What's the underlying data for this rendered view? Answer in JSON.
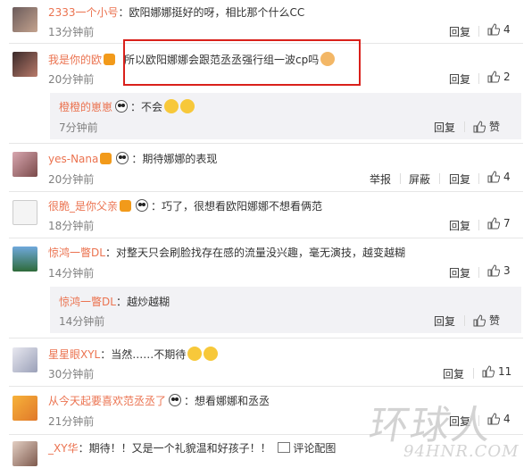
{
  "comments": [
    {
      "name": "2333一个小号",
      "text": "：欧阳娜娜挺好的呀，相比那个什么CC",
      "time": "13分钟前",
      "actions": [
        "回复"
      ],
      "likes": "4"
    },
    {
      "name": "我是你的欧",
      "text": "所以欧阳娜娜会跟范丞丞强行组一波cp吗",
      "time": "20分钟前",
      "actions": [
        "回复"
      ],
      "likes": "2"
    },
    {
      "name": "yes-Nana",
      "text": "：期待娜娜的表现",
      "time": "20分钟前",
      "actions": [
        "举报",
        "屏蔽",
        "回复"
      ],
      "likes": "4"
    },
    {
      "name": "很脆_是你父亲",
      "text": "：巧了，很想看欧阳娜娜不想看俩范",
      "time": "18分钟前",
      "actions": [
        "回复"
      ],
      "likes": "7"
    },
    {
      "name": "惊鸿一瞥DL",
      "text": "：对整天只会刷脸找存在感的流量没兴趣，毫无演技，越变越糊",
      "time": "14分钟前",
      "actions": [
        "回复"
      ],
      "likes": "3"
    },
    {
      "name": "星星眼XYL",
      "text": "：当然……不期待",
      "time": "30分钟前",
      "actions": [
        "回复"
      ],
      "likes": "11"
    },
    {
      "name": "从今天起要喜欢范丞丞了",
      "text": "：想看娜娜和丞丞",
      "time": "21分钟前",
      "actions": [
        "回复"
      ],
      "likes": "4"
    },
    {
      "name": "_XY华",
      "text": "：期待！！又是一个礼貌温和好孩子！！",
      "extra": "评论配图"
    }
  ],
  "replies": [
    {
      "name": "橙橙的崽崽",
      "text": "：不会",
      "time": "7分钟前",
      "actions": [
        "回复"
      ],
      "likes": "赞"
    },
    {
      "name": "惊鸿一瞥DL",
      "text": "：越炒越糊",
      "time": "14分钟前",
      "actions": [
        "回复"
      ],
      "likes": "赞"
    }
  ],
  "colors": {
    "name": "#eb7350",
    "highlight": "#d9201b",
    "reply_bg": "#f2f2f5"
  },
  "watermark": {
    "brand": "环球人",
    "site": "94HNR.COM"
  }
}
